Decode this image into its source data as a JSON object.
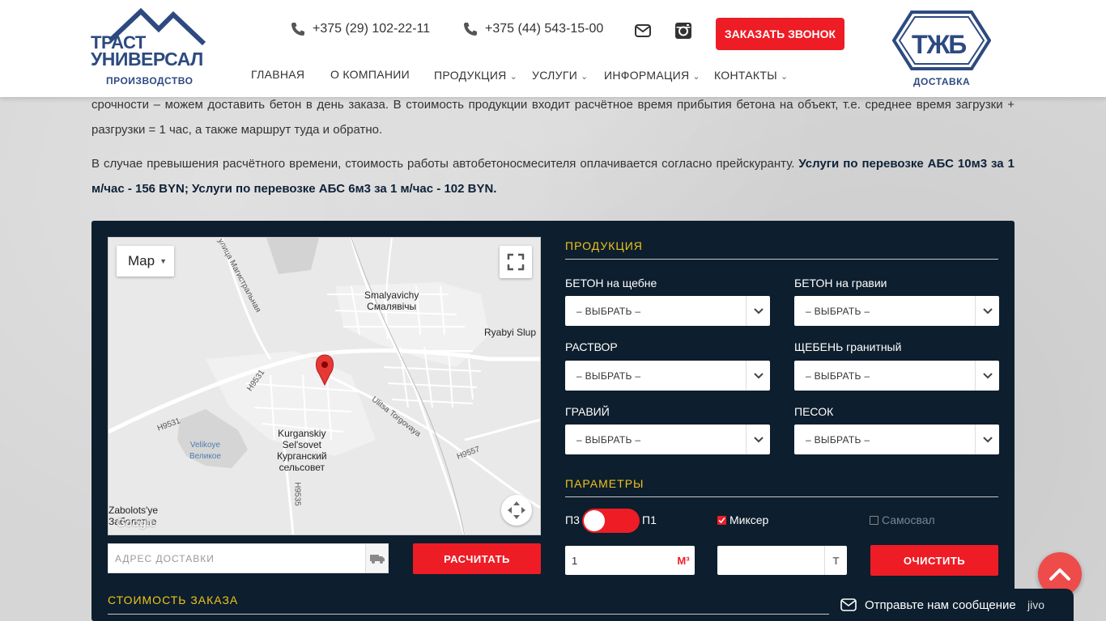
{
  "header": {
    "logo_left": {
      "line1": "ТРАСТ",
      "line2": "УНИВЕРСАЛ",
      "subtitle": "ПРОИЗВОДСТВО"
    },
    "phones": [
      "+375 (29) 102-22-11",
      "+375 (44) 543-15-00"
    ],
    "call_button": "ЗАКАЗАТЬ ЗВОНОК",
    "nav": [
      {
        "label": "ГЛАВНАЯ",
        "has_dropdown": false
      },
      {
        "label": "О КОМПАНИИ",
        "has_dropdown": false
      },
      {
        "label": "ПРОДУКЦИЯ",
        "has_dropdown": true
      },
      {
        "label": "УСЛУГИ",
        "has_dropdown": true
      },
      {
        "label": "ИНФОРМАЦИЯ",
        "has_dropdown": true
      },
      {
        "label": "КОНТАКТЫ",
        "has_dropdown": true
      }
    ],
    "logo_right": {
      "mark": "ТЖБ",
      "subtitle": "ДОСТАВКА"
    },
    "icons": {
      "phone": "phone-icon",
      "mail": "mail-icon",
      "instagram": "instagram-icon"
    },
    "brand_color": "#2d4a80",
    "accent_color": "#ee1c25"
  },
  "content": {
    "para1": "срочности – можем доставить бетон в день заказа. В стоимость продукции входит расчётное время прибытия бетона на объект, т.е. среднее время загрузки + разгрузки = 1 час, а также маршрут туда и обратно.",
    "para2_text": "В случае превышения расчётного времени, стоимость работы автобетоносмесителя оплачивается согласно прейскуранту. ",
    "para2_bold": "Услуги по перевозке АБС 10м3 за 1 м/час - 156 BYN; Услуги по перевозке АБС 6м3 за 1 м/час - 102 BYN."
  },
  "map": {
    "type_button": "Map",
    "labels": {
      "smalyavichy_lat": "Smalyavichy",
      "smalyavichy_cyr": "Смалявічы",
      "ryabyi": "Ryabyi Slup",
      "kurgan_lat1": "Kurganskiy",
      "kurgan_lat2": "Sel'sovet",
      "kurgan_cyr1": "Курганский",
      "kurgan_cyr2": "сельсовет",
      "velikoye1": "Velikoye",
      "velikoye2": "Великое",
      "zabolots1": "Zabolots'ye",
      "zabolots2": "Заболотье",
      "road_h9531a": "H9531",
      "road_h9531b": "H9531",
      "road_h9557": "H9557",
      "road_h9535": "H9535",
      "torgovaya": "Ulitsa Torgovaya",
      "magistralnaya": "улица Магистральная",
      "watermark": "Google"
    }
  },
  "calculator": {
    "address_placeholder": "АДРЕС ДОСТАВКИ",
    "calc_button": "РАСЧИТАТЬ",
    "products_title": "ПРОДУКЦИЯ",
    "fields": [
      {
        "label": "БЕТОН на щебне",
        "value": "– ВЫБРАТЬ –"
      },
      {
        "label": "БЕТОН на гравии",
        "value": "– ВЫБРАТЬ –"
      },
      {
        "label": "РАСТВОР",
        "value": "– ВЫБРАТЬ –"
      },
      {
        "label": "ЩЕБЕНЬ гранитный",
        "value": "– ВЫБРАТЬ –"
      },
      {
        "label": "ГРАВИЙ",
        "value": "– ВЫБРАТЬ –"
      },
      {
        "label": "ПЕСОК",
        "value": "– ВЫБРАТЬ –"
      }
    ],
    "params_title": "ПАРАМЕТРЫ",
    "toggle_left": "П3",
    "toggle_right": "П1",
    "mixer_label": "Миксер",
    "mixer_checked": true,
    "dump_label": "Самосвал",
    "dump_checked": false,
    "qty_value": "1",
    "qty_unit": "М³",
    "weight_value": "",
    "weight_unit": "Т",
    "clear_button": "ОЧИСТИТЬ",
    "cost_title": "СТОИМОСТЬ ЗАКАЗА"
  },
  "chat": {
    "label": "Отправьте нам сообщение",
    "brand": "jivo"
  }
}
